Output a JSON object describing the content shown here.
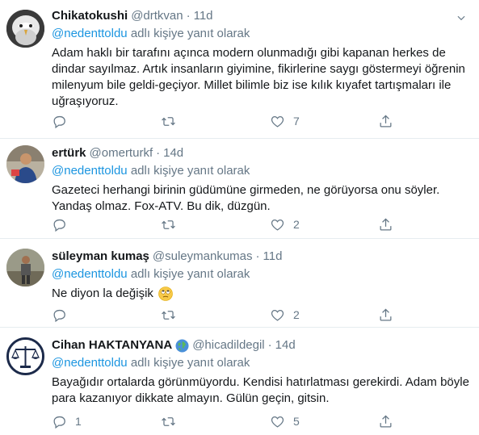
{
  "reply_prefix_suffix": "adlı kişiye yanıt olarak",
  "tweets": [
    {
      "name": "Chikatokushi",
      "handle": "@drtkvan",
      "time": "11d",
      "reply_to": "@nedenttoldu",
      "text": "Adam haklı bir tarafını açınca modern olunmadığı gibi kapanan herkes de dindar sayılmaz. Artık insanların giyimine, fikirlerine saygı göstermeyi öğrenin milenyum bile geldi-geçiyor. Millet bilimle biz ise kılık kıyafet tartışmaları ile uğraşıyoruz.",
      "replies": "",
      "retweets": "",
      "likes": "7",
      "avatar": "eagle-avatar"
    },
    {
      "name": "ertürk",
      "handle": "@omerturkf",
      "time": "14d",
      "reply_to": "@nedenttoldu",
      "text": "Gazeteci herhangi birinin güdümüne girmeden, ne görüyorsa onu söyler. Yandaş olmaz. Fox-ATV. Bu dik, düzgün.",
      "replies": "",
      "retweets": "",
      "likes": "2",
      "avatar": "person-avatar"
    },
    {
      "name": "süleyman kumaş",
      "handle": "@suleymankumas",
      "time": "11d",
      "reply_to": "@nedenttoldu",
      "text": "Ne diyon la değişik",
      "emoji": "rolling-eyes-emoji",
      "replies": "",
      "retweets": "",
      "likes": "2",
      "avatar": "person-standing-avatar"
    },
    {
      "name": "Cihan HAKTANYANA",
      "handle": "@hicadildegil",
      "time": "14d",
      "reply_to": "@nedenttoldu",
      "text": "Bayağıdır ortalarda görünmüyordu. Kendisi hatırlatması gerekirdi. Adam böyle para kazanıyor dikkate almayın. Gülün geçin, gitsin.",
      "replies": "1",
      "retweets": "",
      "likes": "5",
      "avatar": "scales-of-justice-avatar",
      "badge": "globe-emoji"
    }
  ],
  "colors": {
    "link": "#1b95e0",
    "muted": "#657786",
    "text": "#14171a",
    "border": "#e6ecf0"
  }
}
